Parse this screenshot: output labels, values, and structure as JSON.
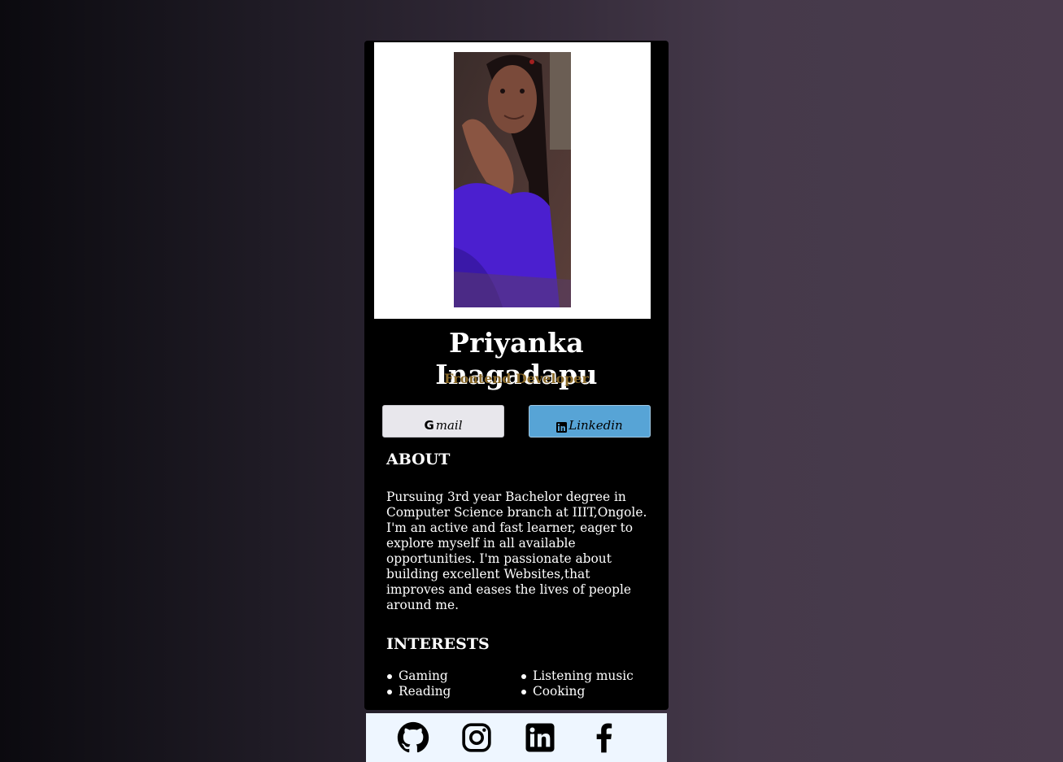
{
  "profile": {
    "name": "Priyanka Inagadapu",
    "role": "Frontend Developer",
    "photo_alt": "Profile photo"
  },
  "contact_buttons": {
    "gmail": {
      "icon_text": "G",
      "label": "mail",
      "icon": "google-icon"
    },
    "linkedin": {
      "icon_text": "in",
      "label": "Linkedin",
      "icon": "linkedin-icon"
    }
  },
  "about": {
    "title": "ABOUT",
    "text": "Pursuing 3rd year Bachelor degree in Computer Science branch at IIIT,Ongole. I'm an active and fast learner, eager to explore myself in all available opportunities. I'm passionate about building excellent Websites,that improves and eases the lives of people around me."
  },
  "interests": {
    "title": "INTERESTS",
    "items": [
      "Gaming",
      "Listening music",
      "Reading",
      "Cooking"
    ]
  },
  "footer": {
    "icons": [
      "github-icon",
      "instagram-icon",
      "linkedin-icon",
      "facebook-icon"
    ]
  },
  "colors": {
    "card_bg": "#000000",
    "role_text": "#8a6a2a",
    "gmail_button": "#e8e7ec",
    "linkedin_button": "#57a4d6",
    "footer_bg": "#eef6ff"
  }
}
